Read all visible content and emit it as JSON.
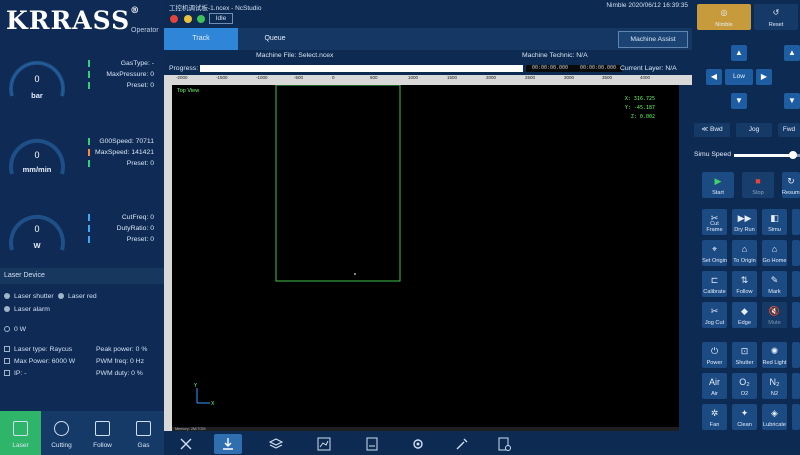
{
  "left_panel": {
    "logo": "KRRASS",
    "logo_mark": "®",
    "role": "Operator",
    "gauges": [
      {
        "value": "0",
        "unit": "bar",
        "params": [
          {
            "label": "GasType: -",
            "color": "#2fd17a"
          },
          {
            "label": "MaxPressure: 0",
            "color": "#2fd17a"
          },
          {
            "label": "Preset: 0",
            "color": "#2fd17a"
          }
        ]
      },
      {
        "value": "0",
        "unit": "mm/min",
        "params": [
          {
            "label": "G00Speed: 70711",
            "color": "#2fd17a"
          },
          {
            "label": "MaxSpeed: 141421",
            "color": "#ff8a3d"
          },
          {
            "label": "Preset: 0",
            "color": "#2fd17a"
          }
        ]
      },
      {
        "value": "0",
        "unit": "W",
        "params": [
          {
            "label": "CutFreq: 0",
            "color": "#3fa9f5"
          },
          {
            "label": "DutyRatio: 0",
            "color": "#3fa9f5"
          },
          {
            "label": "Preset: 0",
            "color": "#3fa9f5"
          }
        ]
      }
    ],
    "laser_device": {
      "header": "Laser Device",
      "laser_shutter": "Laser shutter",
      "laser_red": "Laser red",
      "laser_alarm": "Laser alarm",
      "power_readout": "0 W",
      "laser_type": "Laser type:   Raycus",
      "max_power": "Max Power: 6000 W",
      "ip": "IP: -",
      "peak_power": "Peak power: 0 %",
      "pwm_freq": "PWM freq: 0 Hz",
      "pwm_duty": "PWM duty: 0 %"
    },
    "bottom_tabs": [
      {
        "label": "Laser",
        "icon": "laser-icon",
        "active": true
      },
      {
        "label": "Cutting",
        "icon": "cutting-icon",
        "active": false
      },
      {
        "label": "Follow",
        "icon": "follow-icon",
        "active": false
      },
      {
        "label": "Gas",
        "icon": "gas-icon",
        "active": false
      }
    ]
  },
  "center": {
    "window_title": "工控机调试板-1.ncex - NcStudio",
    "status": "Nimble  2020/06/12 16:39:35",
    "state": "Idle",
    "tabs": [
      {
        "label": "Track",
        "active": true
      },
      {
        "label": "Queue",
        "active": false
      }
    ],
    "machine_assist": "Machine Assist",
    "machine_file": "Machine File:  Select.ncex",
    "machine_technic": "Machine Technic:  N/A",
    "progress_label": "Progress:",
    "progress": 0,
    "time_elapsed": "00:00:00.000",
    "time_total": "00:00:00.000",
    "current_layer": "Current Layer: N/A",
    "ruler_ticks": [
      "-2000",
      "-1500",
      "-1000",
      "-500",
      "0",
      "500",
      "1000",
      "1500",
      "2000",
      "2500",
      "3000",
      "3500",
      "4000"
    ],
    "view_label": "Top View",
    "coords": {
      "x": "X:  316.725",
      "y": "Y:  -45.187",
      "z": "Z:   0.002"
    },
    "footer_text": "Memory: 2M/TOM",
    "toolbar_icons": [
      "tools-icon",
      "track-icon",
      "layers-icon",
      "chart-icon",
      "document-icon",
      "settings-icon",
      "wrench-icon",
      "report-icon"
    ]
  },
  "right_panel": {
    "nimble": "Nimble",
    "reset": "Reset",
    "low": "Low",
    "bwd": "Bwd",
    "jog": "Jog",
    "fwd": "Fwd",
    "simu_speed": "Simu Speed",
    "simu_speed_fraction": 0.9,
    "start": "Start",
    "stop": "Stop",
    "resume": "Resume",
    "grid": [
      [
        "Cut Frame",
        "Dry Run",
        "Simu",
        ""
      ],
      [
        "Set Origin",
        "To Origin",
        "Go Home",
        ""
      ],
      [
        "Calibrate",
        "Follow",
        "Mark",
        ""
      ],
      [
        "Jog Cut",
        "Edge",
        "Mute",
        ""
      ],
      [
        "Power",
        "Shutter",
        "Red Light",
        ""
      ],
      [
        "Air",
        "O2",
        "N2",
        ""
      ],
      [
        "Fan",
        "Clean",
        "Lubricate",
        ""
      ]
    ],
    "grid_glyphs": [
      [
        "✂",
        "▶▶",
        "◧",
        ""
      ],
      [
        "⌖",
        "⌂",
        "⌂",
        ""
      ],
      [
        "⊏",
        "⇅",
        "✎",
        ""
      ],
      [
        "✂",
        "◆",
        "🔇",
        ""
      ],
      [
        "⏻",
        "⊡",
        "✺",
        ""
      ],
      [
        "Air",
        "O₂",
        "N₂",
        ""
      ],
      [
        "✲",
        "✦",
        "◈",
        ""
      ]
    ]
  }
}
